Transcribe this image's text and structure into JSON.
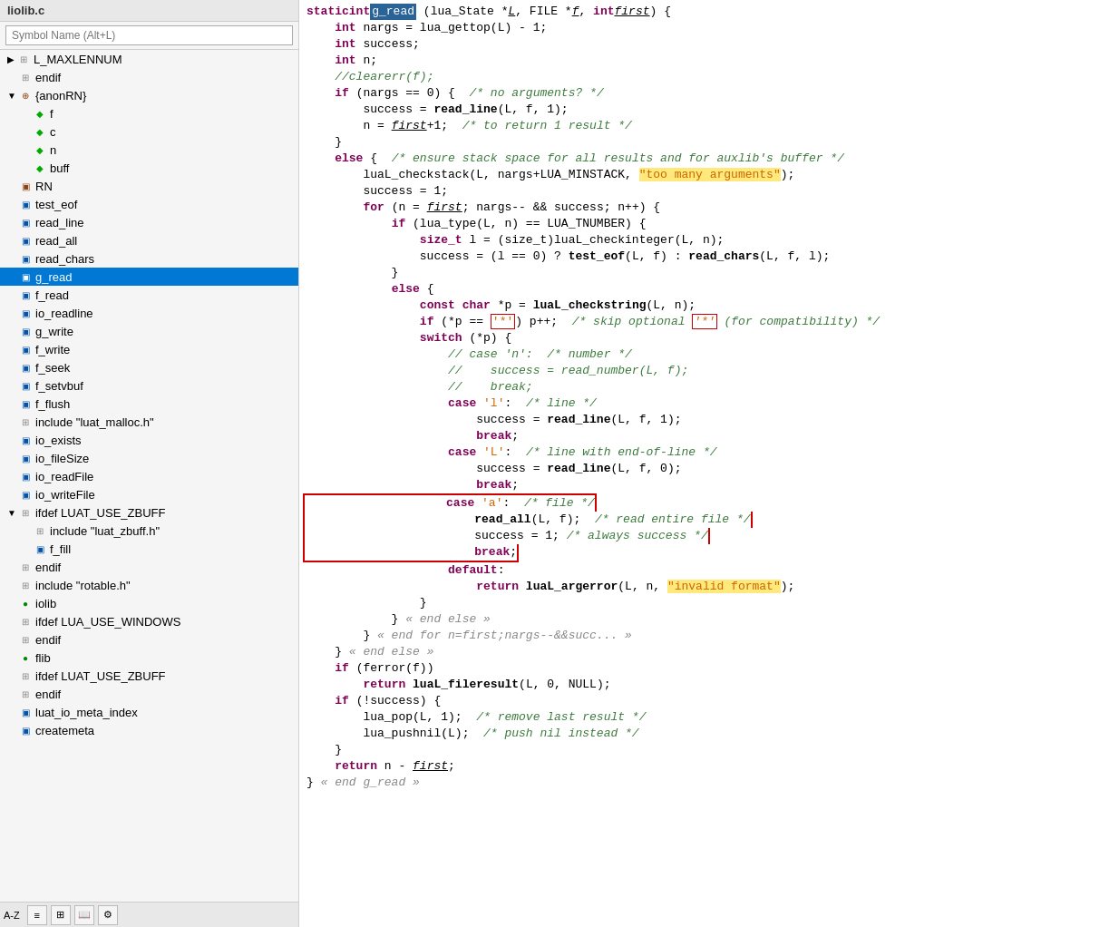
{
  "sidebar": {
    "title": "liolib.c",
    "search_placeholder": "Symbol Name (Alt+L)",
    "items": [
      {
        "id": "L_MAXLENNUM",
        "label": "L_MAXLENNUM",
        "icon": "define",
        "indent": 0,
        "expanded": false
      },
      {
        "id": "endif",
        "label": "endif",
        "icon": "define",
        "indent": 0
      },
      {
        "id": "anonRN",
        "label": "{anonRN}",
        "icon": "struct",
        "indent": 0,
        "expanded": true
      },
      {
        "id": "f",
        "label": "f",
        "icon": "field",
        "indent": 1
      },
      {
        "id": "c",
        "label": "c",
        "icon": "field",
        "indent": 1
      },
      {
        "id": "n",
        "label": "n",
        "icon": "field",
        "indent": 1
      },
      {
        "id": "buff",
        "label": "buff",
        "icon": "field",
        "indent": 1
      },
      {
        "id": "RN",
        "label": "RN",
        "icon": "type",
        "indent": 0
      },
      {
        "id": "test_eof",
        "label": "test_eof",
        "icon": "func",
        "indent": 0
      },
      {
        "id": "read_line",
        "label": "read_line",
        "icon": "func",
        "indent": 0
      },
      {
        "id": "read_all",
        "label": "read_all",
        "icon": "func",
        "indent": 0
      },
      {
        "id": "read_chars",
        "label": "read_chars",
        "icon": "func",
        "indent": 0
      },
      {
        "id": "g_read",
        "label": "g_read",
        "icon": "func",
        "indent": 0,
        "selected": true
      },
      {
        "id": "f_read",
        "label": "f_read",
        "icon": "func",
        "indent": 0
      },
      {
        "id": "io_readline",
        "label": "io_readline",
        "icon": "func",
        "indent": 0
      },
      {
        "id": "g_write",
        "label": "g_write",
        "icon": "func",
        "indent": 0
      },
      {
        "id": "f_write",
        "label": "f_write",
        "icon": "func",
        "indent": 0
      },
      {
        "id": "f_seek",
        "label": "f_seek",
        "icon": "func",
        "indent": 0
      },
      {
        "id": "f_setvbuf",
        "label": "f_setvbuf",
        "icon": "func",
        "indent": 0
      },
      {
        "id": "f_flush",
        "label": "f_flush",
        "icon": "func",
        "indent": 0
      },
      {
        "id": "include_luat_malloc",
        "label": "include \"luat_malloc.h\"",
        "icon": "define",
        "indent": 0
      },
      {
        "id": "io_exists",
        "label": "io_exists",
        "icon": "func",
        "indent": 0
      },
      {
        "id": "io_fileSize",
        "label": "io_fileSize",
        "icon": "func",
        "indent": 0
      },
      {
        "id": "io_readFile",
        "label": "io_readFile",
        "icon": "func",
        "indent": 0
      },
      {
        "id": "io_writeFile",
        "label": "io_writeFile",
        "icon": "func",
        "indent": 0
      },
      {
        "id": "ifdef_LUAT_USE_ZBUFF",
        "label": "ifdef LUAT_USE_ZBUFF",
        "icon": "define",
        "indent": 0,
        "expanded": true
      },
      {
        "id": "include_luat_zbuff",
        "label": "include \"luat_zbuff.h\"",
        "icon": "define",
        "indent": 1
      },
      {
        "id": "f_fill",
        "label": "f_fill",
        "icon": "func",
        "indent": 1
      },
      {
        "id": "endif2",
        "label": "endif",
        "icon": "define",
        "indent": 0
      },
      {
        "id": "include_rotable",
        "label": "include \"rotable.h\"",
        "icon": "define",
        "indent": 0
      },
      {
        "id": "iolib",
        "label": "iolib",
        "icon": "global",
        "indent": 0
      },
      {
        "id": "ifdef_LUA_USE_WINDOWS",
        "label": "ifdef LUA_USE_WINDOWS",
        "icon": "define",
        "indent": 0
      },
      {
        "id": "endif3",
        "label": "endif",
        "icon": "define",
        "indent": 0
      },
      {
        "id": "flib",
        "label": "flib",
        "icon": "global",
        "indent": 0
      },
      {
        "id": "ifdef_LUAT_USE_ZBUFF2",
        "label": "ifdef LUAT_USE_ZBUFF",
        "icon": "define",
        "indent": 0
      },
      {
        "id": "endif4",
        "label": "endif",
        "icon": "define",
        "indent": 0
      },
      {
        "id": "luat_io_meta_index",
        "label": "luat_io_meta_index",
        "icon": "func",
        "indent": 0
      },
      {
        "id": "createmeta",
        "label": "createmeta",
        "icon": "func",
        "indent": 0
      }
    ]
  },
  "code": {
    "title": "liolib.c",
    "highlighted_func": "g_read",
    "lines": [
      "static int <HL>g_read</HL> (lua_State *<U>L</U>, FILE *<U>f</U>, int <U>first</U>) {",
      "    int nargs = lua_gettop(L) - 1;",
      "    int success;",
      "    int n;",
      "    //clearerr(f);",
      "    if (nargs == 0) {  /* no arguments? */",
      "        success = <B>read_line</B>(L, f, 1);",
      "        n = <U>first</U>+1;  /* to return 1 result */",
      "    }",
      "    else {  /* ensure stack space for all results and for auxlib's buffer */",
      "        luaL_checkstack(L, nargs+LUA_MINSTACK, <STR>\"too many arguments\"</STR>);",
      "        success = 1;",
      "        for (n = <U>first</U>; nargs-- && success; n++) {",
      "            if (lua_type(L, n) == LUA_TNUMBER) {",
      "                size_t l = (size_t)luaL_checkinteger(L, n);",
      "                success = (l == 0) ? <B>test_eof</B>(L, f) : <B>read_chars</B>(L, f, l);",
      "            }",
      "            else {",
      "                const char *p = <B>luaL_checkstring</B>(L, n);",
      "                if (*p == <STR2>'*'</STR2>) p++;  /* skip optional <STR2>'*'</STR2> (for compatibility) */",
      "                switch (*p) {",
      "                    // case 'n':  /* number */",
      "                    //    success = read_number(L, f);",
      "                    //    break;",
      "                    case 'l':  /* line */",
      "                        success = <B>read_line</B>(L, f, 1);",
      "                        break;",
      "                    case 'L':  /* line with end-of-line */",
      "                        success = <B>read_line</B>(L, f, 0);",
      "                        break;",
      "BOXSTART",
      "                    case 'a':  /* file */",
      "                        <B>read_all</B>(L, f);  /* read entire file */",
      "                        success = 1; /* always success */",
      "                        break;",
      "BOXEND",
      "                    default:",
      "                        return <B>luaL_argerror</B>(L, n, <STR>\"invalid format\"</STR>);",
      "                }",
      "            } « end else »",
      "        } « end for n=first;nargs--&&succ... »",
      "    } « end else »",
      "    if (ferror(f))",
      "        return <B>luaL_fileresult</B>(L, 0, NULL);",
      "    if (!success) {",
      "        lua_pop(L, 1);  /* remove last result */",
      "        lua_pushnil(L);  /* push nil instead */",
      "    }",
      "    return n - <U>first</U>;",
      "} « end g_read »"
    ]
  },
  "bottom_bar": {
    "buttons": [
      "A-Z",
      "list",
      "tree",
      "book",
      "gear"
    ]
  }
}
